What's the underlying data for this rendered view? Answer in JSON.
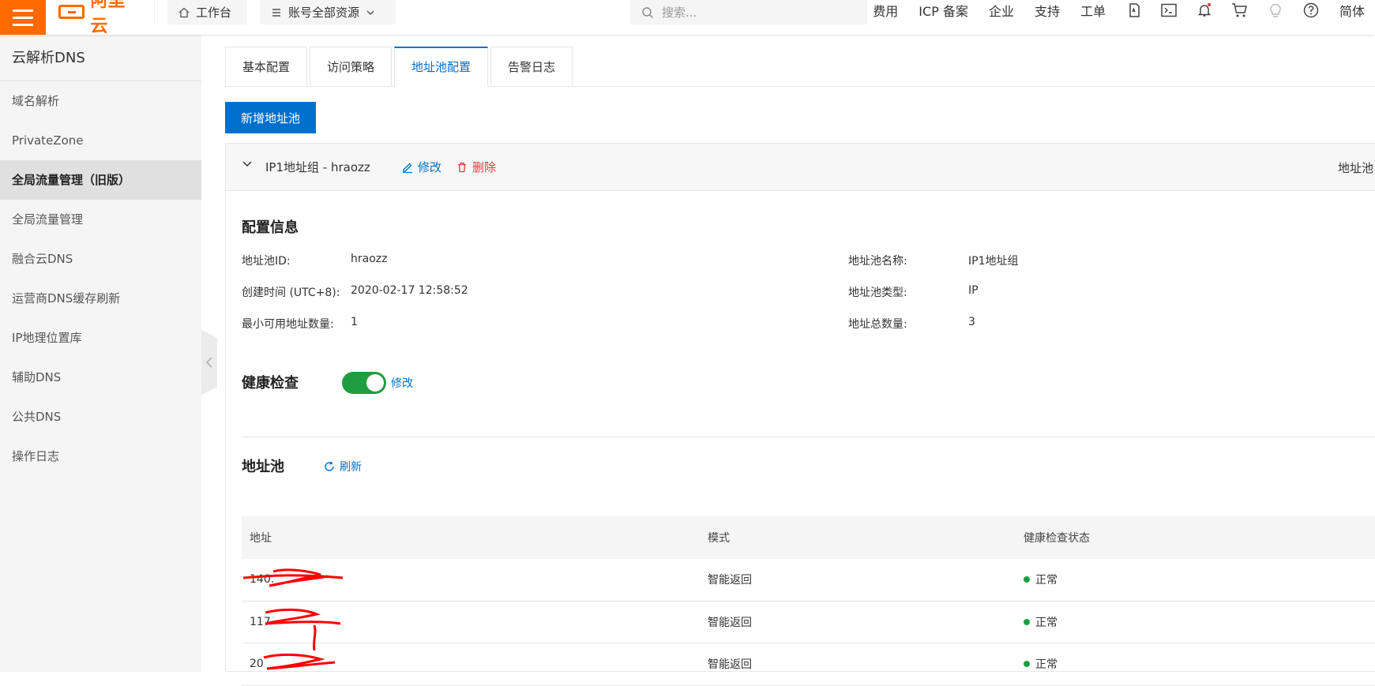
{
  "topbar": {
    "logo_text": "阿里云",
    "workbench": "工作台",
    "resources": "账号全部资源",
    "search_placeholder": "搜索...",
    "nav": [
      "费用",
      "ICP 备案",
      "企业",
      "支持",
      "工单"
    ],
    "language": "简体"
  },
  "sidebar": {
    "title": "云解析DNS",
    "items": [
      {
        "label": "域名解析"
      },
      {
        "label": "PrivateZone"
      },
      {
        "label": "全局流量管理（旧版）"
      },
      {
        "label": "全局流量管理"
      },
      {
        "label": "融合云DNS"
      },
      {
        "label": "运营商DNS缓存刷新"
      },
      {
        "label": "IP地理位置库"
      },
      {
        "label": "辅助DNS"
      },
      {
        "label": "公共DNS"
      },
      {
        "label": "操作日志"
      }
    ]
  },
  "tabs": [
    "基本配置",
    "访问策略",
    "地址池配置",
    "告警日志"
  ],
  "add_pool_button": "新增地址池",
  "pool": {
    "name": "IP1地址组 - hraozz",
    "edit": "修改",
    "delete": "删除",
    "right_label": "地址池"
  },
  "config": {
    "title": "配置信息",
    "id_label": "地址池ID:",
    "id_value": "hraozz",
    "created_label": "创建时间 (UTC+8):",
    "created_value": "2020-02-17 12:58:52",
    "min_label": "最小可用地址数量:",
    "min_value": "1",
    "name_label": "地址池名称:",
    "name_value": "IP1地址组",
    "type_label": "地址池类型:",
    "type_value": "IP",
    "total_label": "地址总数量:",
    "total_value": "3"
  },
  "health": {
    "title": "健康检查",
    "edit": "修改"
  },
  "address_pool": {
    "title": "地址池",
    "refresh": "刷新",
    "columns": [
      "地址",
      "模式",
      "健康检查状态"
    ],
    "rows": [
      {
        "address": "140.",
        "mode": "智能返回",
        "status": "正常"
      },
      {
        "address": "117",
        "mode": "智能返回",
        "status": "正常"
      },
      {
        "address": "20",
        "mode": "智能返回",
        "status": "正常"
      }
    ]
  }
}
